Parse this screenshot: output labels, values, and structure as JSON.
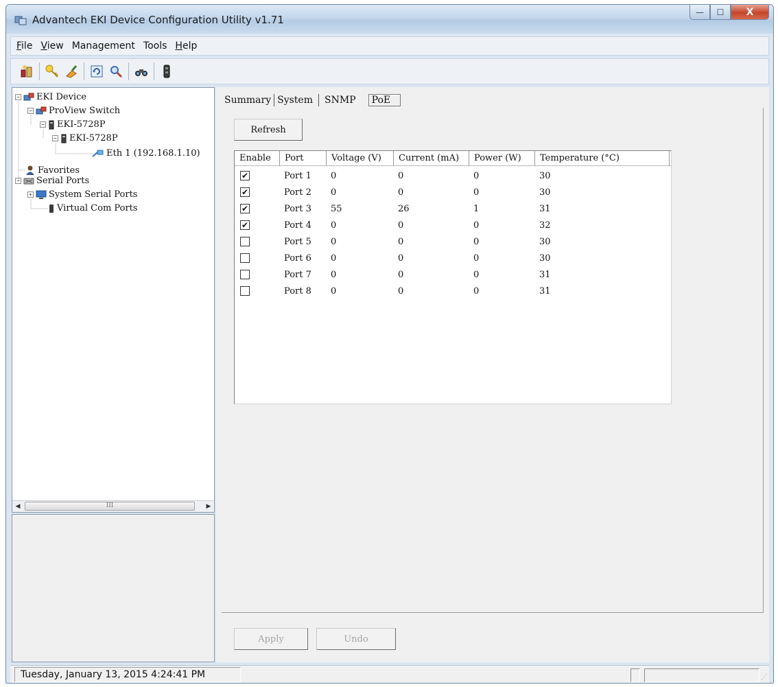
{
  "window": {
    "title": "Advantech EKI Device Configuration Utility v1.71",
    "controls": {
      "minimize": "—",
      "maximize": "☐",
      "close": "X"
    }
  },
  "menubar": {
    "items": [
      {
        "label": "File",
        "mnemonic": "F"
      },
      {
        "label": "View",
        "mnemonic": "V"
      },
      {
        "label": "Management"
      },
      {
        "label": "Tools"
      },
      {
        "label": "Help",
        "mnemonic": "H"
      }
    ]
  },
  "toolbar": {
    "icons": [
      "device-search-icon",
      "key-icon",
      "sweep-icon",
      "refresh-icon",
      "magnifier-icon",
      "binoculars-icon",
      "serial-port-icon"
    ]
  },
  "tree": {
    "root": "EKI Device",
    "group": "ProView Switch",
    "model_parent": "EKI-5728P",
    "model_child": "EKI-5728P",
    "interface": "Eth 1 (192.168.1.10)",
    "favorites": "Favorites",
    "serial_ports": "Serial Ports",
    "system_serial_ports": "System Serial Ports",
    "virtual_com_ports": "Virtual Com Ports",
    "scroll_thumb_glyph": "III"
  },
  "tabs": [
    {
      "label": "Summary"
    },
    {
      "label": "System"
    },
    {
      "label": "SNMP"
    },
    {
      "label": "PoE",
      "active": true
    }
  ],
  "buttons": {
    "refresh": "Refresh",
    "apply": "Apply",
    "undo": "Undo"
  },
  "poe_table": {
    "columns": [
      "Enable",
      "Port",
      "Voltage (V)",
      "Current (mA)",
      "Power (W)",
      "Temperature (°C)"
    ],
    "rows": [
      {
        "enabled": true,
        "port": "Port 1",
        "voltage": "0",
        "current": "0",
        "power": "0",
        "temperature": "30"
      },
      {
        "enabled": true,
        "port": "Port 2",
        "voltage": "0",
        "current": "0",
        "power": "0",
        "temperature": "30"
      },
      {
        "enabled": true,
        "port": "Port 3",
        "voltage": "55",
        "current": "26",
        "power": "1",
        "temperature": "31"
      },
      {
        "enabled": true,
        "port": "Port 4",
        "voltage": "0",
        "current": "0",
        "power": "0",
        "temperature": "32"
      },
      {
        "enabled": false,
        "port": "Port 5",
        "voltage": "0",
        "current": "0",
        "power": "0",
        "temperature": "30"
      },
      {
        "enabled": false,
        "port": "Port 6",
        "voltage": "0",
        "current": "0",
        "power": "0",
        "temperature": "30"
      },
      {
        "enabled": false,
        "port": "Port 7",
        "voltage": "0",
        "current": "0",
        "power": "0",
        "temperature": "31"
      },
      {
        "enabled": false,
        "port": "Port 8",
        "voltage": "0",
        "current": "0",
        "power": "0",
        "temperature": "31"
      }
    ]
  },
  "statusbar": {
    "datetime": "Tuesday, January 13, 2015  4:24:41 PM"
  },
  "colors": {
    "titlebar": "#c4d7ec",
    "close_button": "#c4452c",
    "pane_background": "#f0f0f0"
  }
}
